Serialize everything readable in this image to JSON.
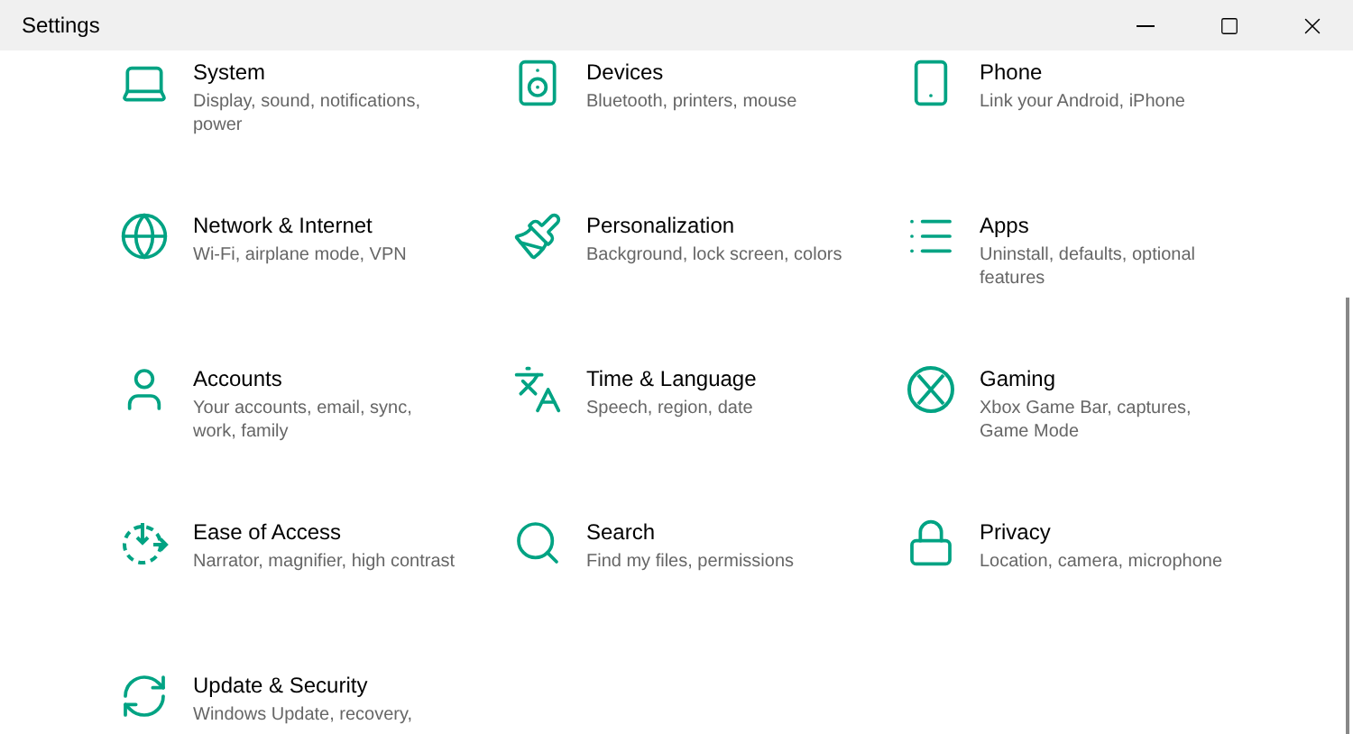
{
  "window": {
    "title": "Settings"
  },
  "categories": [
    {
      "kind": "system",
      "title": "System",
      "description": "Display, sound, notifications, power"
    },
    {
      "kind": "devices",
      "title": "Devices",
      "description": "Bluetooth, printers, mouse"
    },
    {
      "kind": "phone",
      "title": "Phone",
      "description": "Link your Android, iPhone"
    },
    {
      "kind": "network",
      "title": "Network & Internet",
      "description": "Wi-Fi, airplane mode, VPN"
    },
    {
      "kind": "personalization",
      "title": "Personalization",
      "description": "Background, lock screen, colors"
    },
    {
      "kind": "apps",
      "title": "Apps",
      "description": "Uninstall, defaults, optional features"
    },
    {
      "kind": "accounts",
      "title": "Accounts",
      "description": "Your accounts, email, sync, work, family"
    },
    {
      "kind": "time",
      "title": "Time & Language",
      "description": "Speech, region, date"
    },
    {
      "kind": "gaming",
      "title": "Gaming",
      "description": "Xbox Game Bar, captures, Game Mode"
    },
    {
      "kind": "ease",
      "title": "Ease of Access",
      "description": "Narrator, magnifier, high contrast"
    },
    {
      "kind": "search",
      "title": "Search",
      "description": "Find my files, permissions"
    },
    {
      "kind": "privacy",
      "title": "Privacy",
      "description": "Location, camera, microphone"
    },
    {
      "kind": "update",
      "title": "Update & Security",
      "description": "Windows Update, recovery,"
    }
  ]
}
